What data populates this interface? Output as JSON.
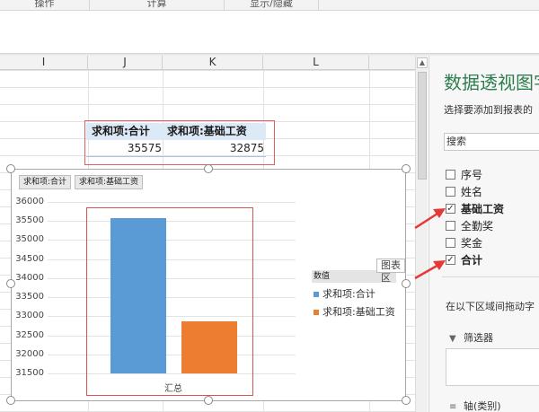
{
  "ribbon": {
    "groups": [
      "操作",
      "计算",
      "显示/隐藏"
    ]
  },
  "sheet": {
    "columns": [
      "I",
      "J",
      "K",
      "L"
    ],
    "pivot": {
      "headers": [
        "求和项:合计",
        "求和项:基础工资"
      ],
      "values": [
        "35575",
        "32875"
      ]
    }
  },
  "chart": {
    "field_buttons": [
      "求和项:合计",
      "求和项:基础工资"
    ],
    "tooltip": "图表区",
    "legend_title": "数值",
    "colors": {
      "series1": "#5b9bd5",
      "series2": "#ed7d31"
    }
  },
  "chart_data": {
    "type": "bar",
    "categories": [
      "汇总"
    ],
    "series": [
      {
        "name": "求和项:合计",
        "values": [
          35575
        ]
      },
      {
        "name": "求和项:基础工资",
        "values": [
          32875
        ]
      }
    ],
    "ylim": [
      31500,
      36000
    ],
    "yticks": [
      "36000",
      "35500",
      "35000",
      "34500",
      "34000",
      "33500",
      "33000",
      "32500",
      "32000",
      "31500"
    ],
    "legend": "right"
  },
  "pane": {
    "title": "数据透视图字",
    "subtitle": "选择要添加到报表的",
    "search_placeholder": "搜索",
    "fields": [
      {
        "label": "序号",
        "checked": false
      },
      {
        "label": "姓名",
        "checked": false
      },
      {
        "label": "基础工资",
        "checked": true
      },
      {
        "label": "全勤奖",
        "checked": false
      },
      {
        "label": "奖金",
        "checked": false
      },
      {
        "label": "合计",
        "checked": true
      }
    ],
    "areas_label": "在以下区域间拖动字",
    "filter_title": "筛选器",
    "axis_title": "轴(类别)"
  }
}
